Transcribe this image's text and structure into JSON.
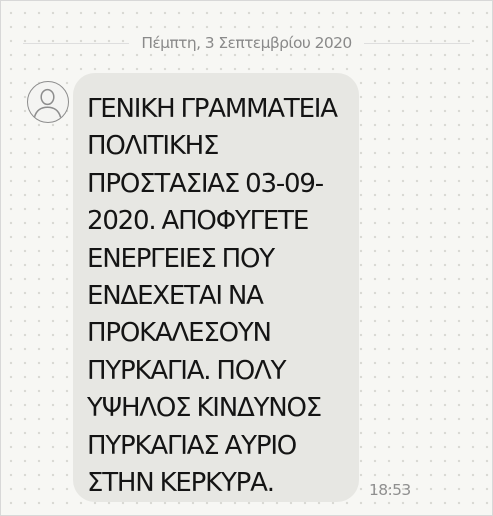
{
  "conversation": {
    "date_separator": "Πέμπτη, 3 Σεπτεμβρίου 2020"
  },
  "message": {
    "text": "ΓΕΝΙΚΗ ΓΡΑΜΜΑΤΕΙΑ\nΠΟΛΙΤΙΚΗΣ\nΠΡΟΣΤΑΣΙΑΣ 03-09-\n2020. ΑΠΟΦΥΓΕΤΕ\nΕΝΕΡΓΕΙΕΣ ΠΟΥ\nΕΝΔΕΧΕΤΑΙ ΝΑ\nΠΡΟΚΑΛΕΣΟΥΝ\nΠΥΡΚΑΓΙΑ. ΠΟΛΥ\nΥΨΗΛΟΣ ΚΙΝΔΥΝΟΣ\nΠΥΡΚΑΓΙΑΣ ΑΥΡΙΟ\nΣΤΗΝ ΚΕΡΚΥΡΑ.",
    "time": "18:53",
    "sender_avatar_icon": "person-icon"
  },
  "colors": {
    "background": "#f7f7f4",
    "bubble": "#e7e7e3",
    "text": "#141414",
    "meta_text": "#8a8a8a"
  }
}
